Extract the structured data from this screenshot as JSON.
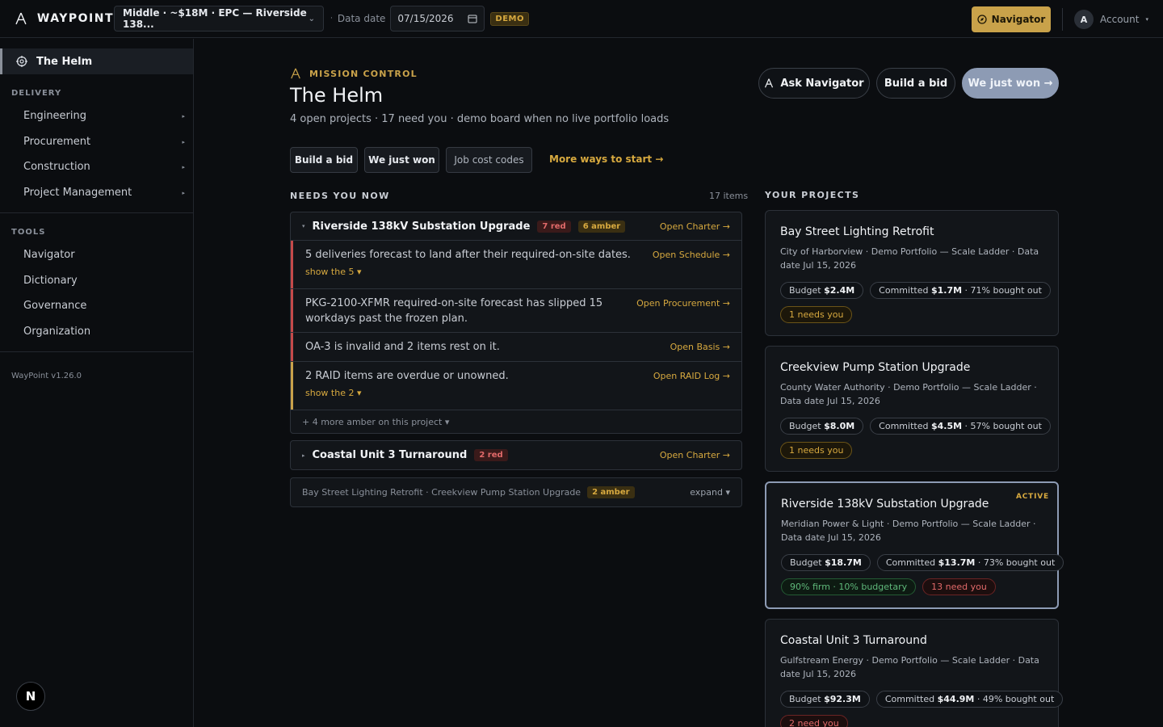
{
  "brand": {
    "name": "WAYPOINT",
    "icon": "waypoint-logo-icon"
  },
  "topbar": {
    "project_selector": "Middle · ~$18M · EPC — Riverside 138...",
    "data_date_label": "Data date",
    "data_date_value": "07/15/2026",
    "demo_badge": "DEMO",
    "navigator_button": "Navigator",
    "account_initial": "A",
    "account_label": "Account"
  },
  "sidebar": {
    "helm": "The Helm",
    "delivery_label": "DELIVERY",
    "delivery_items": [
      "Engineering",
      "Procurement",
      "Construction",
      "Project Management"
    ],
    "tools_label": "TOOLS",
    "tools_items": [
      "Navigator",
      "Dictionary",
      "Governance",
      "Organization"
    ],
    "version": "WayPoint v1.26.0",
    "fab_letter": "N"
  },
  "main": {
    "kicker": "MISSION CONTROL",
    "title": "The Helm",
    "subtitle": "4 open projects · 17 need you · demo board when no live portfolio loads",
    "header_buttons": {
      "ask": "Ask Navigator",
      "bid": "Build a bid",
      "won": "We just won →"
    },
    "quick": {
      "bid": "Build a bid",
      "won": "We just won",
      "codes": "Job cost codes",
      "more": "More ways to start →"
    },
    "needs_label": "NEEDS YOU NOW",
    "needs_count": "17 items",
    "projects_label": "YOUR PROJECTS"
  },
  "needs": {
    "group1": {
      "name": "Riverside 138kV Substation Upgrade",
      "red": "7 red",
      "amber": "6 amber",
      "link": "Open Charter →",
      "rows": [
        {
          "text": "5 deliveries forecast to land after their required-on-site dates.",
          "link": "Open Schedule →",
          "show": "show the 5 ▾"
        },
        {
          "text": "PKG-2100-XFMR required-on-site forecast has slipped 15 workdays past the frozen plan.",
          "link": "Open Procurement →"
        },
        {
          "text": "OA-3 is invalid and 2 items rest on it.",
          "link": "Open Basis →"
        },
        {
          "text": "2 RAID items are overdue or unowned.",
          "link": "Open RAID Log →",
          "show": "show the 2 ▾"
        }
      ],
      "more": "+ 4 more amber on this project ▾"
    },
    "group2": {
      "name": "Coastal Unit 3 Turnaround",
      "red": "2 red",
      "link": "Open Charter →"
    },
    "group3": {
      "text": "Bay Street Lighting Retrofit · Creekview Pump Station Upgrade",
      "amber": "2 amber",
      "link": "expand ▾"
    }
  },
  "projects": [
    {
      "title": "Bay Street Lighting Retrofit",
      "meta": "City of Harborview · Demo Portfolio — Scale Ladder · Data date Jul 15, 2026",
      "budget_label": "Budget",
      "budget": "$2.4M",
      "committed_label": "Committed",
      "committed": "$1.7M",
      "bought": "· 71% bought out",
      "tag": "1 needs you"
    },
    {
      "title": "Creekview Pump Station Upgrade",
      "meta": "County Water Authority · Demo Portfolio — Scale Ladder · Data date Jul 15, 2026",
      "budget_label": "Budget",
      "budget": "$8.0M",
      "committed_label": "Committed",
      "committed": "$4.5M",
      "bought": "· 57% bought out",
      "tag": "1 needs you"
    },
    {
      "title": "Riverside 138kV Substation Upgrade",
      "active": "ACTIVE",
      "meta": "Meridian Power & Light · Demo Portfolio — Scale Ladder · Data date Jul 15, 2026",
      "budget_label": "Budget",
      "budget": "$18.7M",
      "committed_label": "Committed",
      "committed": "$13.7M",
      "bought": "· 73% bought out",
      "firm": "90% firm · 10% budgetary",
      "tag": "13 need you"
    },
    {
      "title": "Coastal Unit 3 Turnaround",
      "meta": "Gulfstream Energy · Demo Portfolio — Scale Ladder · Data date Jul 15, 2026",
      "budget_label": "Budget",
      "budget": "$92.3M",
      "committed_label": "Committed",
      "committed": "$44.9M",
      "bought": "· 49% bought out",
      "tag": "2 need you"
    }
  ],
  "colors": {
    "accent": "#c9a24a",
    "red": "#e26a6a",
    "active_border": "#8d9bb4"
  }
}
